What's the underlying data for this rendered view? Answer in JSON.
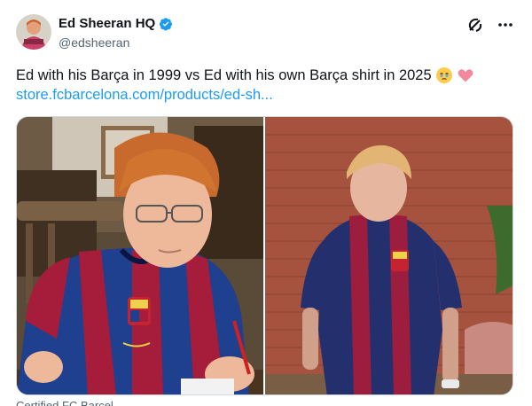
{
  "author": {
    "display_name": "Ed Sheeran HQ",
    "handle": "@edsheeran",
    "verified": true
  },
  "tweet": {
    "text": "Ed with his Barça in 1999 vs Ed with his own Barça shirt in 2025",
    "emojis": [
      "face-holding-back-tears",
      "pink-heart"
    ],
    "link_text": "store.fcbarcelona.com/products/ed-sh..."
  },
  "icons": {
    "verified": "verified-badge-icon",
    "grok": "grok-icon",
    "more": "more-options-icon"
  },
  "colors": {
    "link": "#1d9bf0",
    "verified": "#1d9bf0",
    "text": "#0f1419",
    "muted": "#536471"
  },
  "footer": {
    "text": "Certified FC Barcel..."
  }
}
